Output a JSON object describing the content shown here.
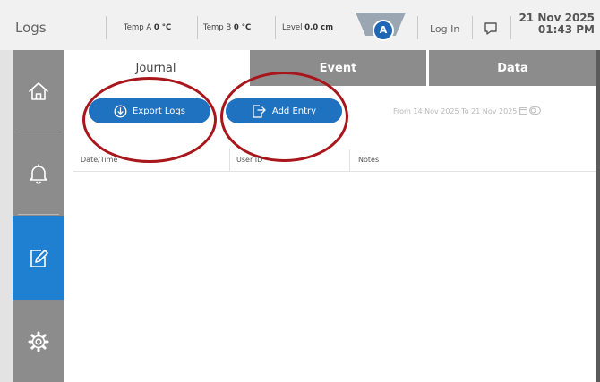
{
  "app": {
    "title": "Logs"
  },
  "status": {
    "temp_a_label": "Temp A",
    "temp_a_value": "0 °C",
    "temp_b_label": "Temp B",
    "temp_b_value": "0 °C",
    "level_label": "Level",
    "level_value": "0.0 cm",
    "badge": "A",
    "login_label": "Log In",
    "date": "21 Nov 2025",
    "time": "01:43 PM"
  },
  "sidebar": {
    "items": [
      {
        "icon": "home-icon"
      },
      {
        "icon": "bell-icon"
      },
      {
        "icon": "edit-icon",
        "active": true
      },
      {
        "icon": "gear-icon"
      }
    ]
  },
  "tabs": [
    {
      "label": "Journal",
      "active": true
    },
    {
      "label": "Event"
    },
    {
      "label": "Data"
    }
  ],
  "journal": {
    "export_label": "Export Logs",
    "add_label": "Add Entry",
    "range_from_label": "From",
    "range_from": "14 Nov 2025",
    "range_to_label": "To",
    "range_to": "21 Nov 2025",
    "columns": [
      "Date/Time",
      "User ID",
      "Notes"
    ]
  },
  "colors": {
    "accent": "#1f72c0",
    "sidebar": "#8c8c8c",
    "sidebar_active": "#1f7fd0",
    "annotation": "#a8151b"
  }
}
